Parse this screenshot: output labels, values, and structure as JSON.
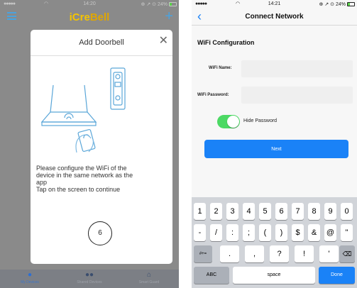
{
  "left": {
    "status": {
      "signal": "●●●●●",
      "time": "14:20",
      "right": "⊕ ↗ ⊙ 24%"
    },
    "brand": {
      "part1": "iCre",
      "part2": "Bell"
    },
    "dialog": {
      "title": "Add Doorbell",
      "message": [
        "Please configure the WiFi of the",
        "device in the same network as the",
        "app",
        "Tap on the screen to continue"
      ],
      "step": "6"
    },
    "tabs": [
      {
        "label": "My Devices",
        "icon": "person-icon"
      },
      {
        "label": "Shared Devices",
        "icon": "people-icon"
      },
      {
        "label": "Smart Guard",
        "icon": "home-icon"
      }
    ]
  },
  "right": {
    "status": {
      "signal": "●●●●●",
      "time": "14:21",
      "right": "⊕ ↗ ⊙ 24%"
    },
    "nav_title": "Connect Network",
    "section": "WiFi Configuration",
    "wifi_name_label": "WiFi Name:",
    "wifi_name_value": "",
    "wifi_password_label": "WiFi Password:",
    "wifi_password_value": "",
    "hide_password_label": "Hide Password",
    "hide_password_on": true,
    "next_label": "Next",
    "keyboard": {
      "row1": [
        "1",
        "2",
        "3",
        "4",
        "5",
        "6",
        "7",
        "8",
        "9",
        "0"
      ],
      "row2": [
        "-",
        "/",
        ":",
        ";",
        "(",
        ")",
        "$",
        "&",
        "@",
        "\""
      ],
      "row3_mode": "#+=",
      "row3": [
        ".",
        ",",
        "?",
        "!",
        "'"
      ],
      "abc": "ABC",
      "space": "space",
      "done": "Done"
    }
  },
  "colors": {
    "accent": "#1a82f7",
    "toggle_on": "#4cd964",
    "brand_yellow": "#f4c400"
  }
}
